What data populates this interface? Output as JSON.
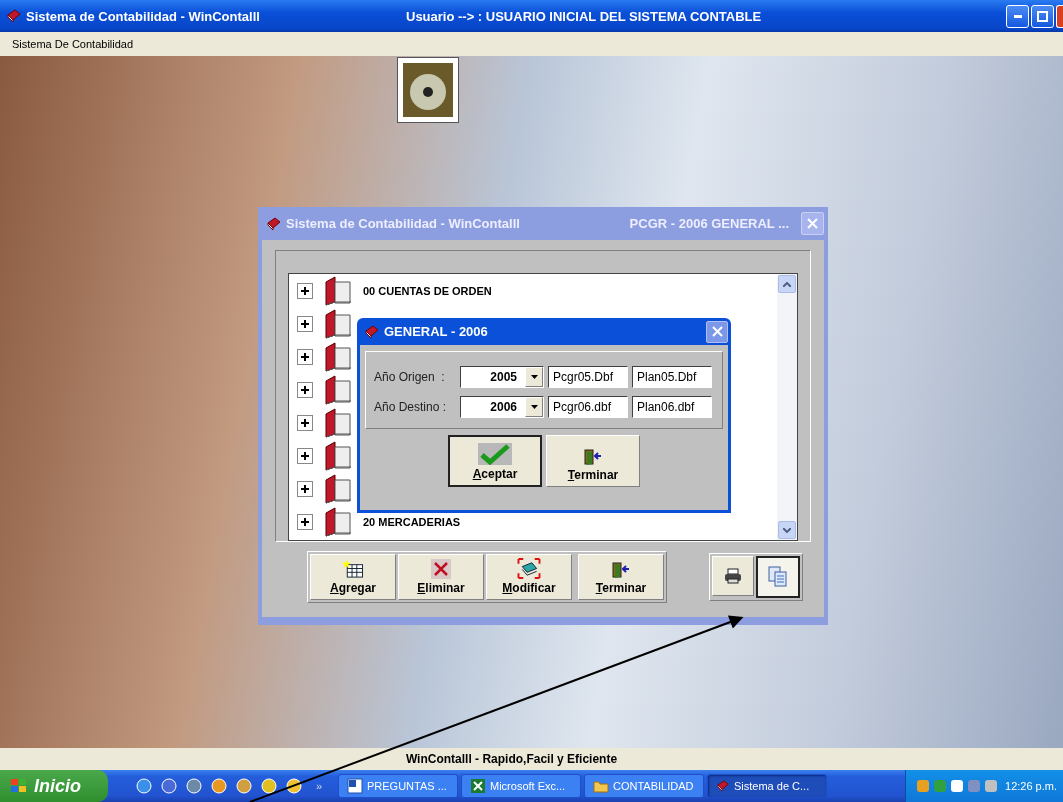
{
  "window": {
    "title": "Sistema de Contabilidad - WinContalll",
    "user": "Usuario --> : USUARIO  INICIAL  DEL  SISTEMA  CONTABLE"
  },
  "menu": [
    "Sistema De Contabilidad"
  ],
  "plan_window": {
    "title": "Sistema de Contabilidad - WinContalll",
    "subtitle": "PCGR - 2006 GENERAL ...",
    "tree": [
      {
        "label": "00 CUENTAS DE ORDEN",
        "expanded": false
      },
      {
        "expanded": false
      },
      {
        "expanded": false
      },
      {
        "expanded": false
      },
      {
        "expanded": false
      },
      {
        "expanded": false
      },
      {
        "expanded": false
      },
      {
        "label": "20 MERCADERIAS",
        "expanded": false
      }
    ],
    "buttons": [
      {
        "label": "Agregar"
      },
      {
        "label": "Eliminar"
      },
      {
        "label": "Modificar"
      },
      {
        "label": "Terminar"
      }
    ],
    "tools": [
      {
        "pressed": false
      },
      {
        "pressed": true
      }
    ]
  },
  "general_dialog": {
    "title": "GENERAL - 2006",
    "rows": [
      {
        "label": "Año Origen  :",
        "year": "2005",
        "file_1": "Pcgr05.Dbf",
        "file_2": "Plan05.Dbf"
      },
      {
        "label": "Año Destino :",
        "year": "2006",
        "file_1": "Pcgr06.dbf",
        "file_2": "Plan06.dbf"
      }
    ],
    "buttons": [
      {
        "label": "Aceptar",
        "default": true
      },
      {
        "label": "Terminar",
        "default": false
      }
    ]
  },
  "status_bar": "WinContalll  - Rapido,Facil y Eficiente",
  "taskbar": {
    "start": "Inicio",
    "more": "»",
    "tasks": [
      {
        "label": "PREGUNTAS ...",
        "selected": false
      },
      {
        "label": "Microsoft Exc...",
        "selected": false
      },
      {
        "label": "CONTABILIDAD",
        "selected": false
      },
      {
        "label": "Sistema de C...",
        "selected": true
      }
    ],
    "clock": "12:26 p.m."
  }
}
